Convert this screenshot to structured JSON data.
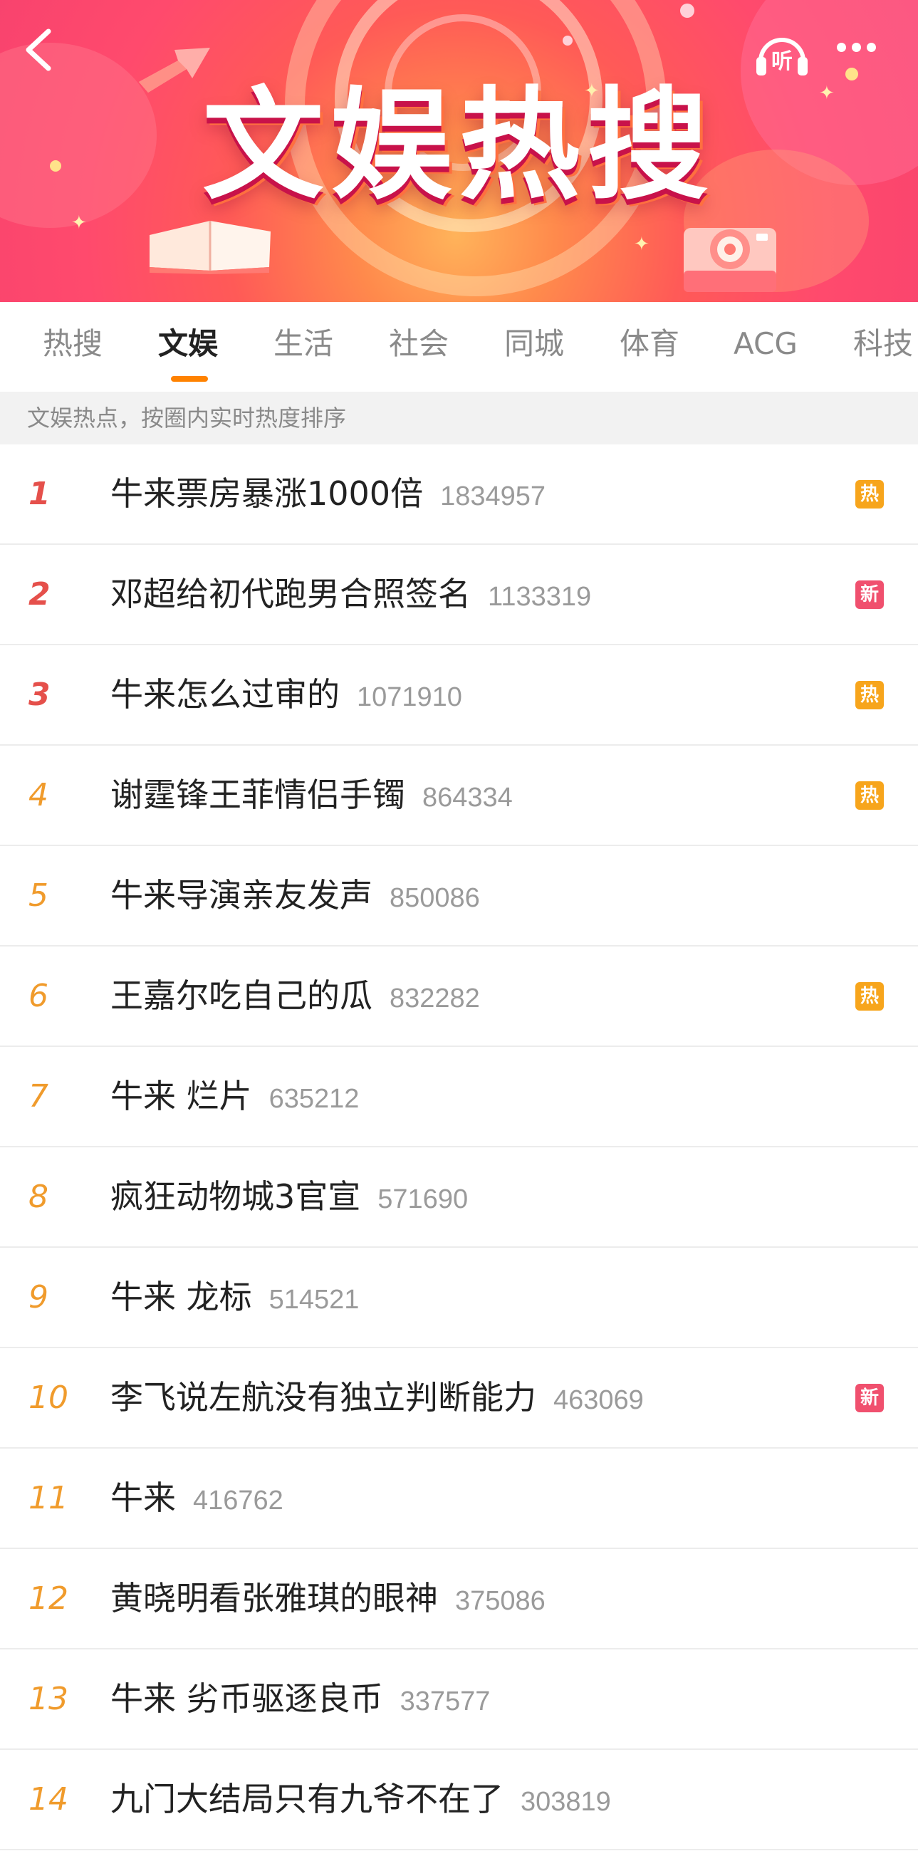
{
  "banner": {
    "title": "文娱热搜",
    "listen_label": "听",
    "colors": {
      "gradient_center": "#ffb35a",
      "gradient_edge": "#f23d6e"
    }
  },
  "tabs": [
    {
      "label": "热搜",
      "active": false
    },
    {
      "label": "文娱",
      "active": true
    },
    {
      "label": "生活",
      "active": false
    },
    {
      "label": "社会",
      "active": false
    },
    {
      "label": "同城",
      "active": false
    },
    {
      "label": "体育",
      "active": false
    },
    {
      "label": "ACG",
      "active": false
    },
    {
      "label": "科技",
      "active": false
    }
  ],
  "subtitle": "文娱热点，按圈内实时热度排序",
  "colors": {
    "accent": "#ff8200",
    "hot_badge": "#f7a51c",
    "new_badge": "#f0506e",
    "rank_top": "#e5504b",
    "rank_other": "#f09b2c"
  },
  "items": [
    {
      "rank": "1",
      "title": "牛来票房暴涨1000倍",
      "count": "1834957",
      "badge": "热",
      "badge_type": "hot"
    },
    {
      "rank": "2",
      "title": "邓超给初代跑男合照签名",
      "count": "1133319",
      "badge": "新",
      "badge_type": "new"
    },
    {
      "rank": "3",
      "title": "牛来怎么过审的",
      "count": "1071910",
      "badge": "热",
      "badge_type": "hot"
    },
    {
      "rank": "4",
      "title": "谢霆锋王菲情侣手镯",
      "count": "864334",
      "badge": "热",
      "badge_type": "hot"
    },
    {
      "rank": "5",
      "title": "牛来导演亲友发声",
      "count": "850086",
      "badge": "",
      "badge_type": ""
    },
    {
      "rank": "6",
      "title": "王嘉尔吃自己的瓜",
      "count": "832282",
      "badge": "热",
      "badge_type": "hot"
    },
    {
      "rank": "7",
      "title": "牛来 烂片",
      "count": "635212",
      "badge": "",
      "badge_type": ""
    },
    {
      "rank": "8",
      "title": "疯狂动物城3官宣",
      "count": "571690",
      "badge": "",
      "badge_type": ""
    },
    {
      "rank": "9",
      "title": "牛来 龙标",
      "count": "514521",
      "badge": "",
      "badge_type": ""
    },
    {
      "rank": "10",
      "title": "李飞说左航没有独立判断能力",
      "count": "463069",
      "badge": "新",
      "badge_type": "new"
    },
    {
      "rank": "11",
      "title": "牛来",
      "count": "416762",
      "badge": "",
      "badge_type": ""
    },
    {
      "rank": "12",
      "title": "黄晓明看张雅琪的眼神",
      "count": "375086",
      "badge": "",
      "badge_type": ""
    },
    {
      "rank": "13",
      "title": "牛来 劣币驱逐良币",
      "count": "337577",
      "badge": "",
      "badge_type": ""
    },
    {
      "rank": "14",
      "title": "九门大结局只有九爷不在了",
      "count": "303819",
      "badge": "",
      "badge_type": ""
    }
  ]
}
